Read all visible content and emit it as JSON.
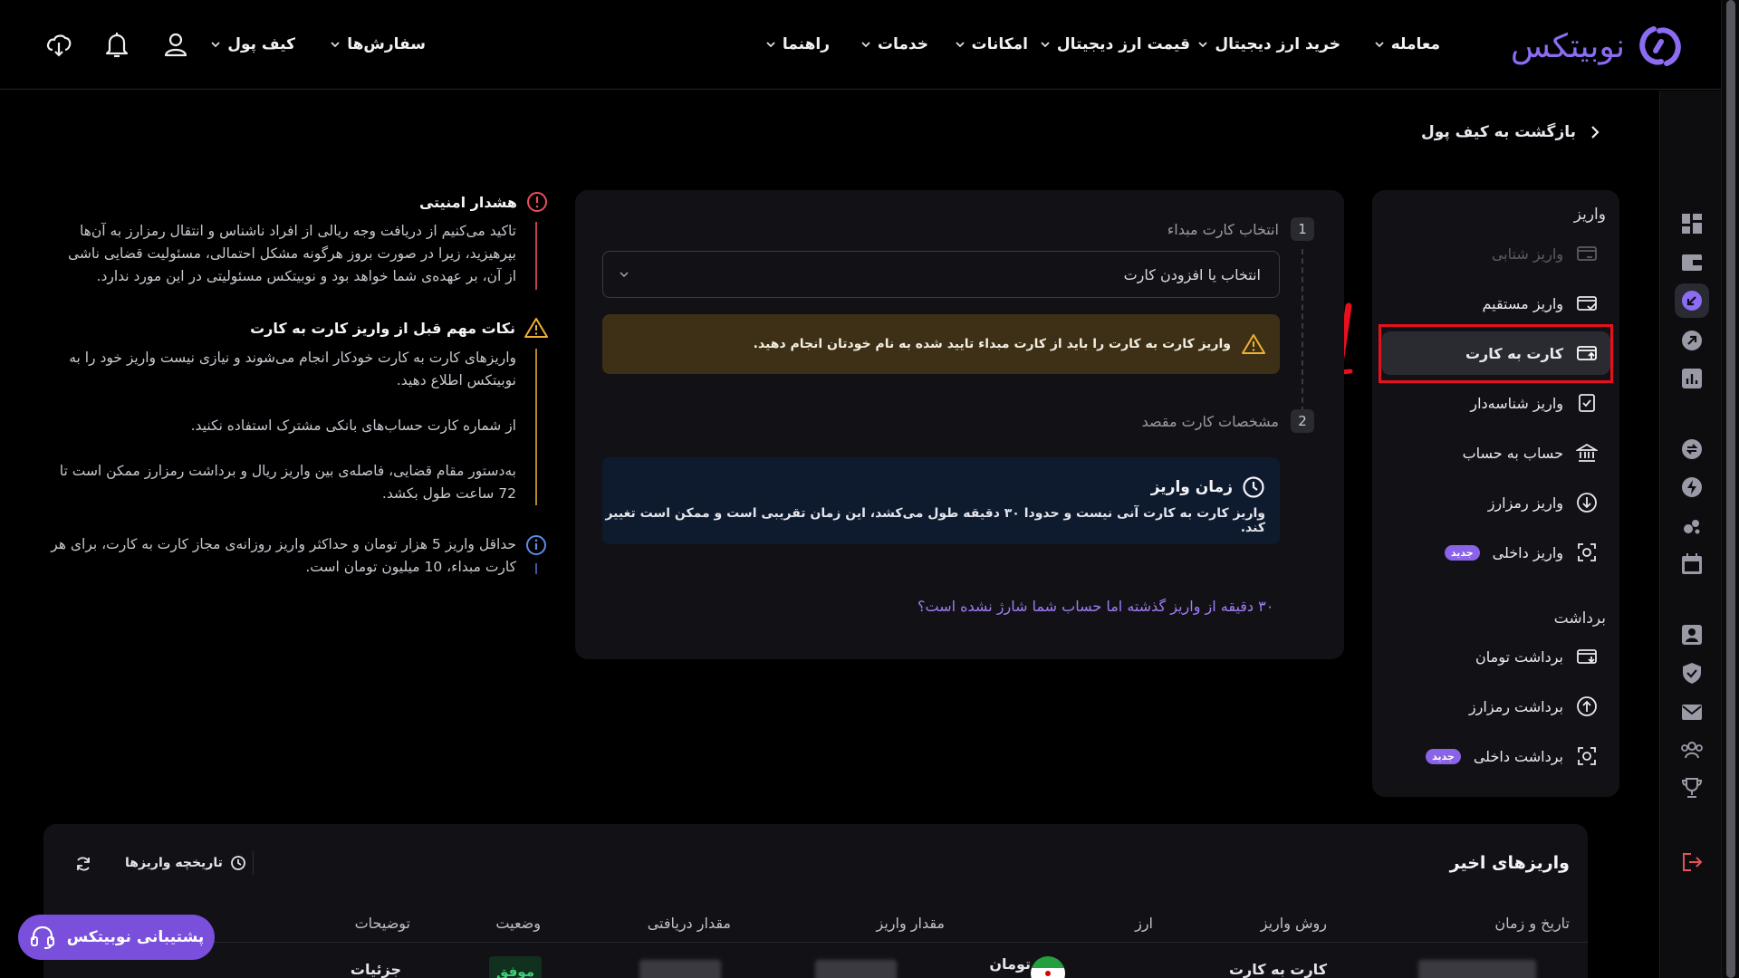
{
  "brand": {
    "logo_text": "نوبیتکس",
    "accent": "#8b6cf2"
  },
  "header": {
    "nav": [
      {
        "label": "معامله"
      },
      {
        "label": "خرید ارز دیجیتال"
      },
      {
        "label": "قیمت ارز دیجیتال"
      },
      {
        "label": "امکانات"
      },
      {
        "label": "خدمات"
      },
      {
        "label": "راهنما"
      },
      {
        "label": "سفارش‌ها"
      },
      {
        "label": "کیف پول"
      }
    ],
    "icons": [
      "user-icon",
      "bell-icon",
      "download-app-icon"
    ]
  },
  "back_link": {
    "label": "بازگشت به کیف پول"
  },
  "menu": {
    "deposit_title": "واریز",
    "deposit_items": [
      {
        "label": "واریز شتابی",
        "icon": "card-fast-icon",
        "disabled": true
      },
      {
        "label": "واریز مستقیم",
        "icon": "card-direct-icon"
      },
      {
        "label": "کارت به کارت",
        "icon": "card-transfer-icon",
        "active": true
      },
      {
        "label": "واریز شناسه‌دار",
        "icon": "id-deposit-icon"
      },
      {
        "label": "حساب به حساب",
        "icon": "bank-icon"
      },
      {
        "label": "واریز رمزارز",
        "icon": "crypto-deposit-icon"
      },
      {
        "label": "واریز داخلی",
        "icon": "internal-icon",
        "badge": "جدید"
      }
    ],
    "withdraw_title": "برداشت",
    "withdraw_items": [
      {
        "label": "برداشت تومان",
        "icon": "card-withdraw-icon"
      },
      {
        "label": "برداشت رمزارز",
        "icon": "crypto-withdraw-icon"
      },
      {
        "label": "برداشت داخلی",
        "icon": "internal-icon",
        "badge": "جدید"
      }
    ]
  },
  "card": {
    "step1_num": "1",
    "step1_label": "انتخاب کارت مبداء",
    "select_placeholder": "انتخاب یا افزودن کارت",
    "warning": "واریز کارت به کارت را باید از کارت مبداء تایید شده به نام خودتان انجام دهید.",
    "step2_num": "2",
    "step2_label": "مشخصات کارت مقصد",
    "time_title": "زمان واریز",
    "time_desc": "واریز کارت به کارت آنی نیست و حدودا ۳۰ دقیقه طول می‌کشد، این زمان تقریبی است و ممکن است تغییر کند.",
    "help_link": "۳۰ دقیقه از واریز گذشته اما حساب شما شارژ نشده است؟"
  },
  "notices": {
    "security_title": "هشدار امنیتی",
    "security_lines": [
      "تاکید می‌کنیم از دریافت وجه ریالی از افراد ناشناس و انتقال رمزارز به آن‌ها",
      "بپرهیزید، زیرا در صورت بروز هرگونه مشکل احتمالی، مسئولیت قضایی ناشی",
      "از آن، بر عهده‌ی شما خواهد بود و نوبیتکس مسئولیتی در این مورد ندارد."
    ],
    "tips_title": "نکات مهم قبل از واریز کارت به کارت",
    "tips_p1_lines": [
      "واریزهای کارت به کارت خودکار انجام می‌شوند و نیازی نیست واریز خود را به",
      "نوبیتکس اطلاع دهید."
    ],
    "tips_p2": "از شماره کارت حساب‌های بانکی مشترک استفاده نکنید.",
    "tips_p3_lines": [
      "به‌دستور مقام قضایی، فاصله‌ی بین واریز ریال و برداشت رمزارز ممکن است تا",
      "72 ساعت طول بکشد."
    ],
    "limit_lines": [
      "حداقل واریز 5 هزار تومان و حداکثر واریز روزانه‌ی مجاز کارت به کارت، برای هر",
      "کارت مبداء، 10 میلیون تومان است."
    ]
  },
  "recent": {
    "title": "واریزهای اخیر",
    "history_label": "تاریخچه واریزها",
    "columns": [
      "تاریخ و زمان",
      "روش واریز",
      "ارز",
      "مقدار واریز",
      "مقدار دریافتی",
      "وضعیت",
      "توضیحات"
    ],
    "row": {
      "method": "کارت به کارت",
      "currency": "تومان",
      "status": "موفق",
      "details": "جزئیات"
    }
  },
  "support": {
    "label": "پشتیبانی نوبیتکس"
  },
  "colors": {
    "background": "#000000",
    "panel": "#121216",
    "warning_bg": "#3d3016",
    "info_bg": "#0e1a2e",
    "link": "#a07cf6",
    "highlight": "#e8101c",
    "success": "#3fcf7a"
  }
}
